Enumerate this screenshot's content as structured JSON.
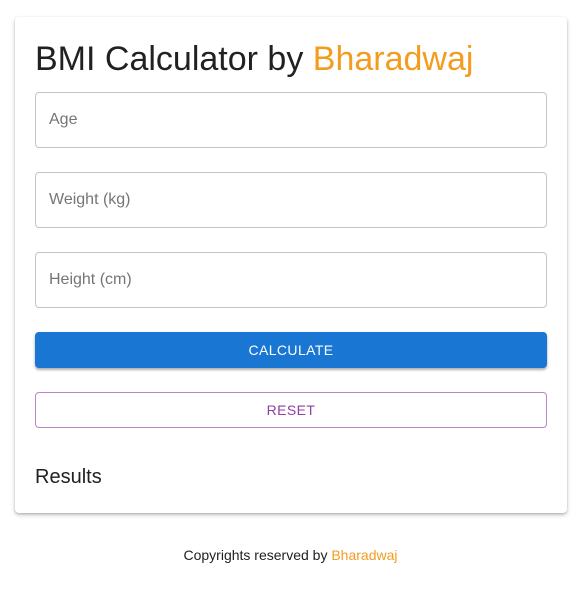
{
  "header": {
    "title_prefix": "BMI Calculator by",
    "title_name": "Bharadwaj"
  },
  "form": {
    "age": {
      "placeholder": "Age",
      "value": ""
    },
    "weight": {
      "placeholder": "Weight (kg)",
      "value": ""
    },
    "height": {
      "placeholder": "Height (cm)",
      "value": ""
    }
  },
  "buttons": {
    "calculate_label": "CALCULATE",
    "reset_label": "RESET"
  },
  "results": {
    "heading": "Results"
  },
  "footer": {
    "prefix": "Copyrights reserved by",
    "name": "Bharadwaj"
  },
  "colors": {
    "accent": "#f39c1f",
    "primary": "#1976d2",
    "secondary": "#8e3ea5"
  }
}
